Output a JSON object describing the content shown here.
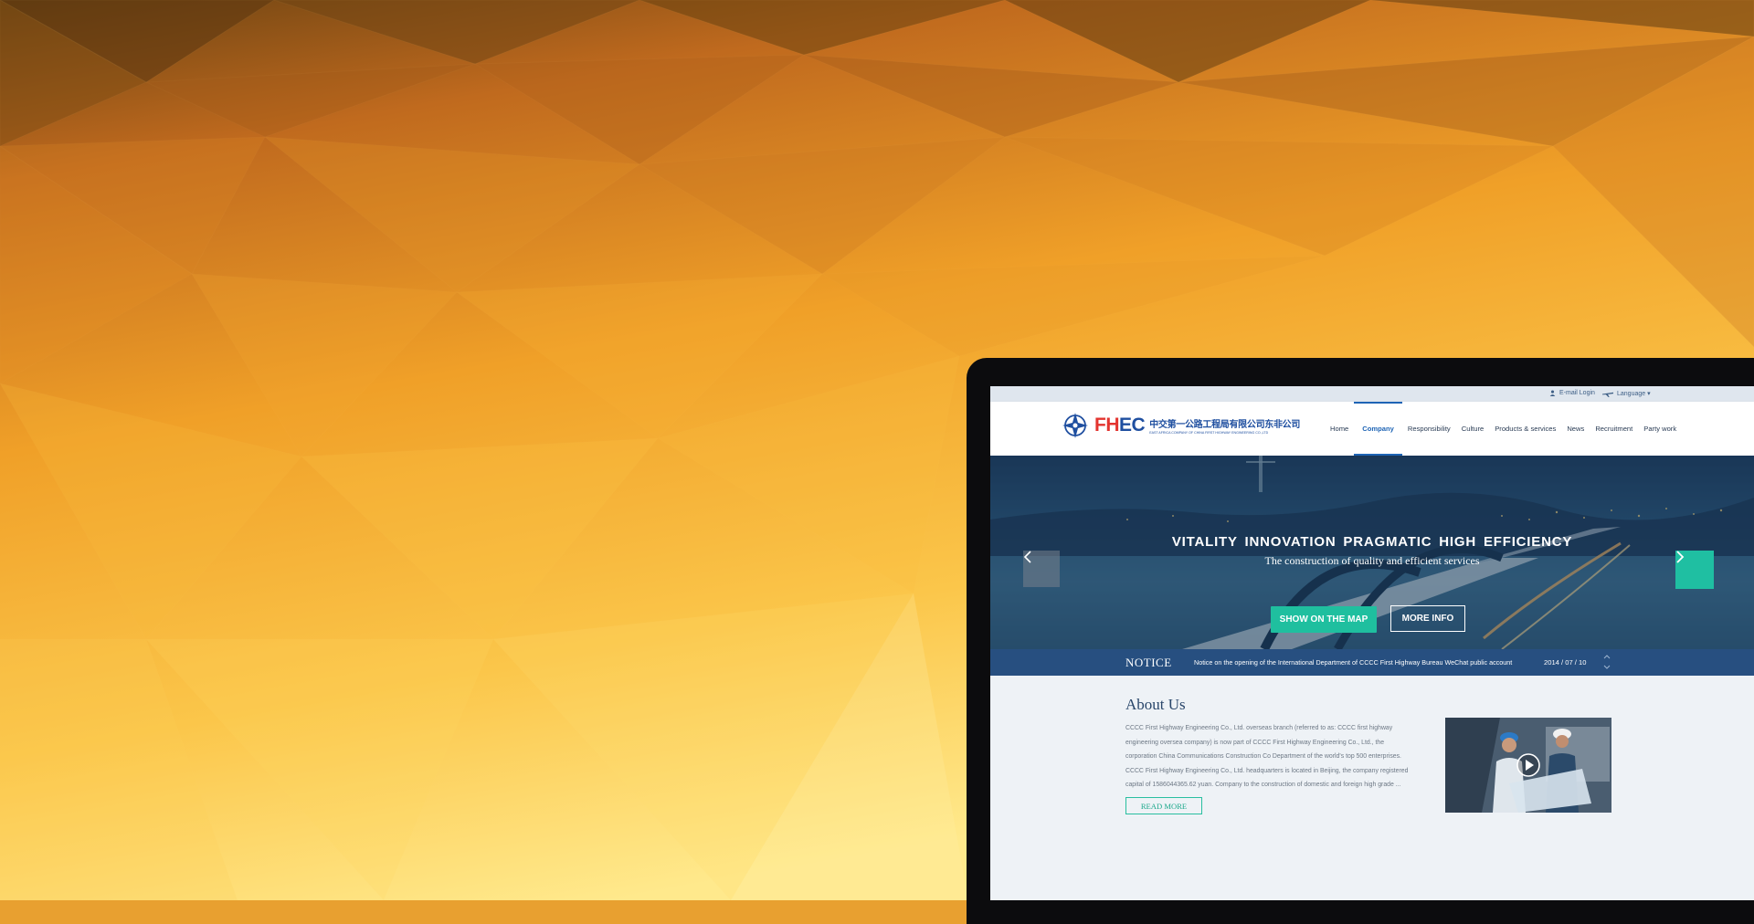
{
  "colors": {
    "background_gradient": [
      "#5e3a10",
      "#b8641e",
      "#f2a32a",
      "#ffd25a",
      "#fff0a0"
    ],
    "nav_active": "#1e64b5",
    "notice_bar": "#274f80",
    "accent_teal": "#1fbf9f",
    "logo_red": "#e3342f",
    "logo_blue": "#1f4fa0"
  },
  "utility_bar": {
    "login_label": "E-mail Login",
    "login_icon": "user-icon",
    "language_label": "Language ▾",
    "language_icon": "plane-icon"
  },
  "logo": {
    "brand_part1": "FH",
    "brand_part2": "EC",
    "chinese_name": "中交第一公路工程局有限公司东非公司",
    "english_name": "EAST AFRICA COMPANY OF CHINA FIRST HIGHWAY ENGINEERING CO.,LTD"
  },
  "nav": {
    "items": [
      {
        "label": "Home",
        "active": false
      },
      {
        "label": "Company",
        "active": true
      },
      {
        "label": "Responsibility",
        "active": false
      },
      {
        "label": "Culture",
        "active": false
      },
      {
        "label": "Products & services",
        "active": false
      },
      {
        "label": "News",
        "active": false
      },
      {
        "label": "Recruitment",
        "active": false
      },
      {
        "label": "Party work",
        "active": false
      }
    ]
  },
  "hero": {
    "title": "VITALITY  INNOVATION  PRAGMATIC  HIGH EFFICIENCY",
    "subtitle": "The construction of quality and efficient services",
    "primary_button": "SHOW ON THE MAP",
    "secondary_button": "MORE INFO",
    "prev_icon": "chevron-left-icon",
    "next_icon": "chevron-right-icon"
  },
  "notice": {
    "label": "NOTICE",
    "text": "Notice on the opening of the International Department of CCCC First Highway Bureau WeChat public account",
    "date": "2014 / 07 / 10"
  },
  "about": {
    "title": "About Us",
    "lines": [
      "CCCC First Highway Engineering Co., Ltd. overseas branch (referred to as: CCCC first highway",
      "engineering oversea company) is now part of CCCC First Highway Engineering Co., Ltd., the",
      "corporation China Communications Construction Co Department of the world's top 500 enterprises.",
      "CCCC First Highway Engineering Co., Ltd. headquarters is located in Beijing, the company registered",
      "capital of 1586044365.62 yuan.  Company to the construction of domestic and foreign high grade ..."
    ],
    "read_more": "READ MORE",
    "video_icon": "play-icon"
  }
}
